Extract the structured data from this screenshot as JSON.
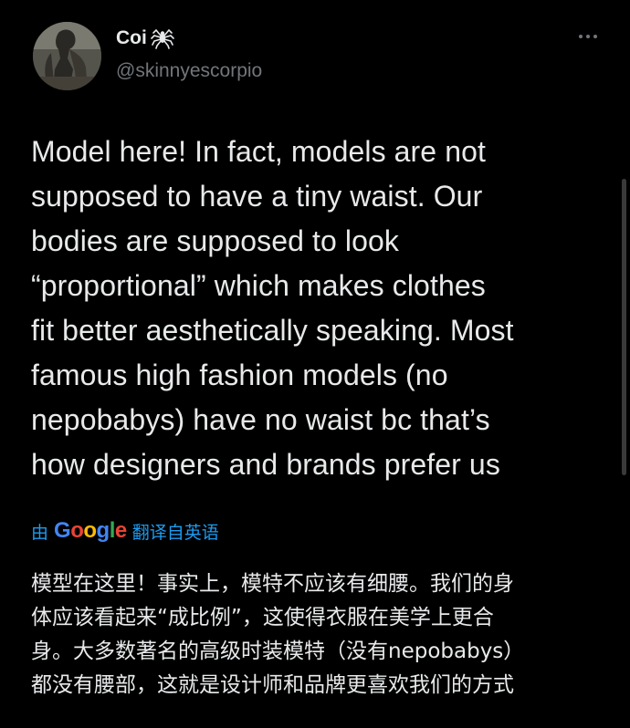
{
  "author": {
    "display_name": "Coi",
    "badge_icon": "spider-icon",
    "handle": "@skinnyescorpio"
  },
  "more_icon": "more-horizontal-icon",
  "tweet": {
    "lines": [
      "Model here! In fact, models are not",
      "supposed to have a tiny waist. Our",
      "bodies are supposed to look",
      "“proportional” which makes clothes",
      "fit better aesthetically speaking. Most",
      "famous high fashion models (no",
      "nepobabys) have no waist bc that’s",
      "how designers and brands prefer us"
    ]
  },
  "translation": {
    "prefix": "由",
    "google_letters": [
      "G",
      "o",
      "o",
      "g",
      "l",
      "e"
    ],
    "suffix": "翻译自英语",
    "lines": [
      "模型在这里！事实上，模特不应该有细腰。我们的身",
      "体应该看起来“成比例”，这使得衣服在美学上更合",
      "身。大多数著名的高级时装模特（没有nepobabys）",
      "都没有腰部，这就是设计师和品牌更喜欢我们的方式"
    ]
  },
  "colors": {
    "background": "#000000",
    "primary_text": "#e7e9ea",
    "secondary_text": "#71767b",
    "link": "#1d9bf0"
  }
}
